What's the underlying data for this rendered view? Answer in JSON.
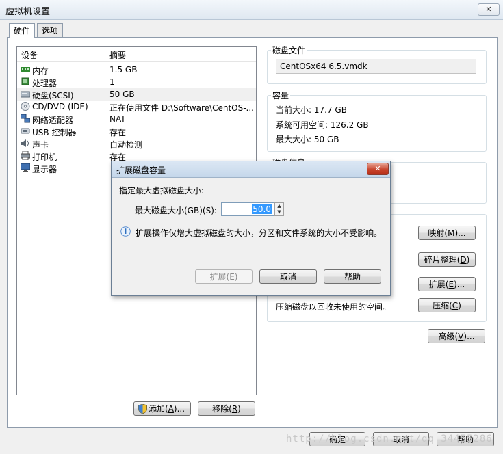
{
  "window": {
    "title": "虚拟机设置",
    "close_label": "✕"
  },
  "tabs": [
    {
      "label": "硬件"
    },
    {
      "label": "选项"
    }
  ],
  "device_list": {
    "col_device": "设备",
    "col_summary": "摘要",
    "rows": [
      {
        "name": "内存",
        "summary": "1.5 GB",
        "icon": "memory-icon"
      },
      {
        "name": "处理器",
        "summary": "1",
        "icon": "processor-icon"
      },
      {
        "name": "硬盘(SCSI)",
        "summary": "50 GB",
        "icon": "harddisk-icon"
      },
      {
        "name": "CD/DVD (IDE)",
        "summary": "正在使用文件 D:\\Software\\CentOS-...",
        "icon": "cdrom-icon"
      },
      {
        "name": "网络适配器",
        "summary": "NAT",
        "icon": "network-icon"
      },
      {
        "name": "USB 控制器",
        "summary": "存在",
        "icon": "usb-icon"
      },
      {
        "name": "声卡",
        "summary": "自动检测",
        "icon": "sound-icon"
      },
      {
        "name": "打印机",
        "summary": "存在",
        "icon": "printer-icon"
      },
      {
        "name": "显示器",
        "summary": "",
        "icon": "display-icon"
      }
    ]
  },
  "add_button": {
    "label": "添加(",
    "key": "A",
    "suffix": ")..."
  },
  "remove_button": {
    "label": "移除(",
    "key": "R",
    "suffix": ")"
  },
  "disk_file": {
    "title": "磁盘文件",
    "value": "CentOSx64 6.5.vmdk"
  },
  "capacity": {
    "title": "容量",
    "current": "当前大小: 17.7 GB",
    "available": "系统可用空间: 126.2 GB",
    "max": "最大大小: 50 GB"
  },
  "disk_info_title": "磁盘信息",
  "utilities": {
    "map": {
      "label": "映射(",
      "key": "M",
      "suffix": ")..."
    },
    "defrag": {
      "label": "碎片整理(",
      "key": "D",
      "suffix": ")"
    },
    "expand": {
      "label": "扩展(",
      "key": "E",
      "suffix": ")..."
    },
    "compact_desc": "压缩磁盘以回收未使用的空间。",
    "compact": {
      "label": "压缩(",
      "key": "C",
      "suffix": ")"
    }
  },
  "advanced": {
    "label": "高级(",
    "key": "V",
    "suffix": ")..."
  },
  "footer": {
    "ok": "确定",
    "cancel": "取消",
    "help": "帮助"
  },
  "dialog": {
    "title": "扩展磁盘容量",
    "instruction": "指定最大虚拟磁盘大小:",
    "size_label": "最大磁盘大小(GB)(S):",
    "size_value": "50.0",
    "info": "扩展操作仅增大虚拟磁盘的大小，分区和文件系统的大小不受影响。",
    "expand": "扩展(E)",
    "cancel": "取消",
    "help": "帮助"
  },
  "watermark": "http://blog.csdn.net/qq_34455286"
}
